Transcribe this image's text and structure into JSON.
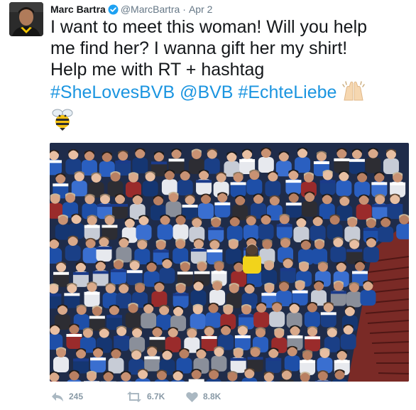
{
  "tweet": {
    "author_name": "Marc Bartra",
    "handle": "@MarcBartra",
    "separator": "·",
    "time": "Apr 2",
    "text_lines": [
      "I want to meet this woman! Will you help",
      "me find her? I wanna gift her my shirt!",
      "Help me with RT + hashtag"
    ],
    "tags": [
      "#SheLovesBVB",
      "@BVB",
      "#EchteLiebe"
    ],
    "icons": {
      "verified": "verified-badge-icon",
      "praise": "raising-hands-icon",
      "bee": "bee-icon"
    },
    "colors": {
      "link": "#1b95e0",
      "meta": "#657786",
      "action": "#8899a6"
    }
  },
  "actions": {
    "reply_count": "245",
    "retweet_count": "6.7K",
    "like_count": "8.8K"
  }
}
